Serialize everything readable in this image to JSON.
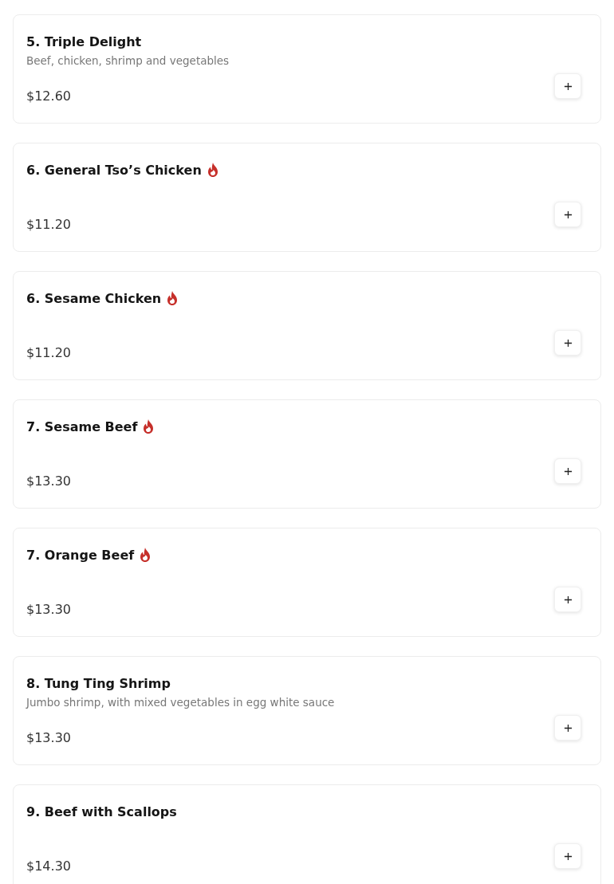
{
  "items": [
    {
      "name": "5. Triple Delight",
      "description": "Beef, chicken, shrimp and vegetables",
      "price": "$12.60",
      "spicy": false
    },
    {
      "name": "6. General Tso’s Chicken",
      "price": "$11.20",
      "spicy": true
    },
    {
      "name": "6. Sesame Chicken",
      "price": "$11.20",
      "spicy": true
    },
    {
      "name": "7. Sesame Beef",
      "price": "$13.30",
      "spicy": true
    },
    {
      "name": "7. Orange Beef",
      "price": "$13.30",
      "spicy": true
    },
    {
      "name": "8. Tung Ting Shrimp",
      "description": "Jumbo shrimp, with mixed vegetables in egg white sauce",
      "price": "$13.30",
      "spicy": false
    },
    {
      "name": "9. Beef with Scallops",
      "price": "$14.30",
      "spicy": false
    }
  ]
}
